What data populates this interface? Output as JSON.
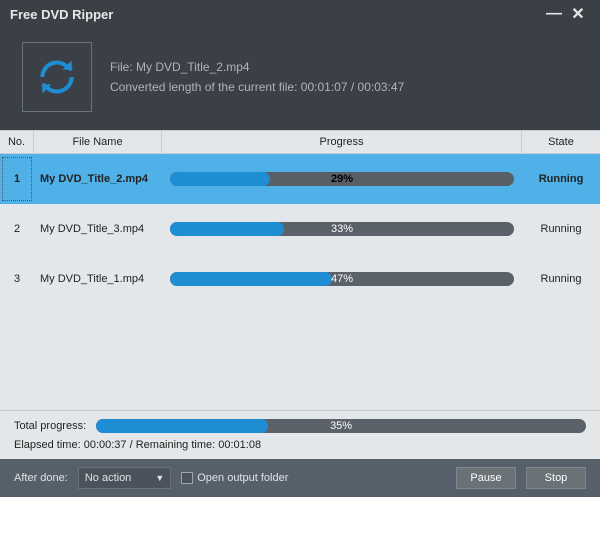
{
  "title": "Free DVD Ripper",
  "info": {
    "file_label": "File:",
    "file_name": "My DVD_Title_2.mp4",
    "converted_label": "Converted length of the current file:",
    "converted_current": "00:01:07",
    "converted_total": "00:03:47"
  },
  "columns": {
    "no": "No.",
    "file": "File Name",
    "progress": "Progress",
    "state": "State"
  },
  "rows": [
    {
      "no": "1",
      "file": "My DVD_Title_2.mp4",
      "percent": 29,
      "percent_label": "29%",
      "state": "Running",
      "selected": true
    },
    {
      "no": "2",
      "file": "My DVD_Title_3.mp4",
      "percent": 33,
      "percent_label": "33%",
      "state": "Running",
      "selected": false
    },
    {
      "no": "3",
      "file": "My DVD_Title_1.mp4",
      "percent": 47,
      "percent_label": "47%",
      "state": "Running",
      "selected": false
    }
  ],
  "total": {
    "label": "Total progress:",
    "percent": 35,
    "percent_label": "35%",
    "elapsed_label": "Elapsed time:",
    "elapsed": "00:00:37",
    "remaining_label": "Remaining time:",
    "remaining": "00:01:08"
  },
  "footer": {
    "after_done_label": "After done:",
    "after_done_value": "No action",
    "open_output_label": "Open output folder",
    "pause": "Pause",
    "stop": "Stop"
  },
  "colors": {
    "accent": "#1e8dd4",
    "select_bg": "#4fb1e8"
  }
}
